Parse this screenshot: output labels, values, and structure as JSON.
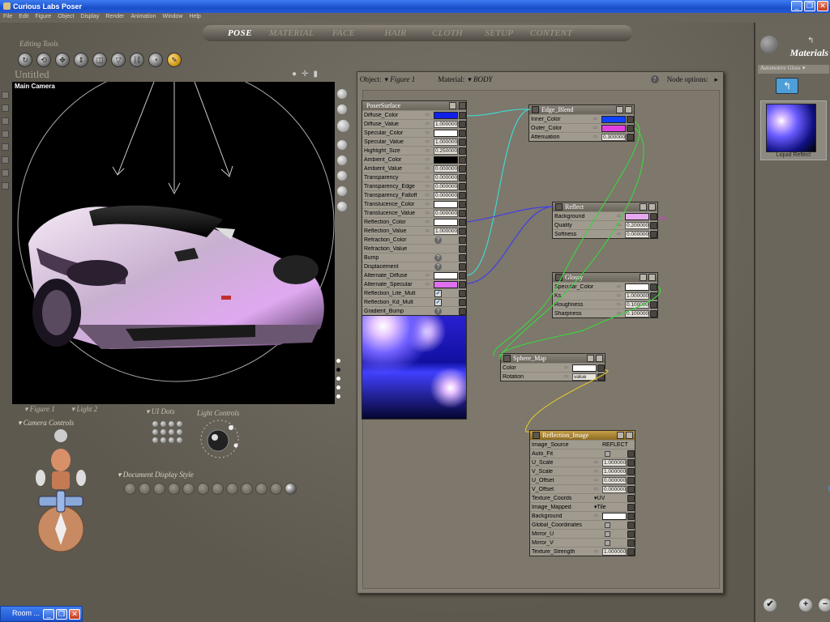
{
  "window": {
    "title": "Curious Labs Poser"
  },
  "menu": [
    "File",
    "Edit",
    "Figure",
    "Object",
    "Display",
    "Render",
    "Animation",
    "Window",
    "Help"
  ],
  "rooms": [
    "POSE",
    "MATERIAL",
    "FACE",
    "HAIR",
    "CLOTH",
    "SETUP",
    "CONTENT"
  ],
  "active_room": "POSE",
  "editing_tools_label": "Editing Tools",
  "document_title": "Untitled",
  "viewport_label": "Main Camera",
  "figure_menu": [
    "Figure 1",
    "Light 2"
  ],
  "ui_dots_label": "UI Dots",
  "light_controls_label": "Light Controls",
  "camera_controls_label": "Camera Controls",
  "document_display_style_label": "Document Display Style",
  "material_panel": {
    "object_label": "Object:",
    "object_value": "Figure 1",
    "material_label": "Material:",
    "material_value": "BODY",
    "help": "?",
    "node_options": "Node options:"
  },
  "nodes": {
    "poser_surface": {
      "title": "PoserSurface",
      "params": [
        {
          "name": "Diffuse_Color",
          "type": "color",
          "color": "#1020e8"
        },
        {
          "name": "Diffuse_Value",
          "type": "value",
          "value": "1.000000"
        },
        {
          "name": "Specular_Color",
          "type": "color",
          "color": "#ffffff"
        },
        {
          "name": "Specular_Value",
          "type": "value",
          "value": "1.000000"
        },
        {
          "name": "Highlight_Size",
          "type": "value",
          "value": "0.250000"
        },
        {
          "name": "Ambient_Color",
          "type": "color",
          "color": "#000000"
        },
        {
          "name": "Ambient_Value",
          "type": "value",
          "value": "0.000000"
        },
        {
          "name": "Transparency",
          "type": "value",
          "value": "0.000000"
        },
        {
          "name": "Transparency_Edge",
          "type": "value",
          "value": "0.000000"
        },
        {
          "name": "Transparency_Falloff",
          "type": "value",
          "value": "0.000000"
        },
        {
          "name": "Translucence_Color",
          "type": "color",
          "color": "#ffffff"
        },
        {
          "name": "Translucence_Value",
          "type": "value",
          "value": "0.000000"
        },
        {
          "name": "Reflection_Color",
          "type": "color",
          "color": "#ffffff"
        },
        {
          "name": "Reflection_Value",
          "type": "value",
          "value": "1.000000"
        },
        {
          "name": "Refraction_Color",
          "type": "q"
        },
        {
          "name": "Refraction_Value",
          "type": "none"
        },
        {
          "name": "Bump",
          "type": "q"
        },
        {
          "name": "Displacement",
          "type": "q"
        },
        {
          "name": "Alternate_Diffuse",
          "type": "color",
          "color": "#ffffff"
        },
        {
          "name": "Alternate_Specular",
          "type": "color",
          "color": "#e070f0"
        },
        {
          "name": "Reflection_Lite_Mult",
          "type": "check"
        },
        {
          "name": "Reflection_Kd_Mult",
          "type": "check"
        },
        {
          "name": "Gradient_Bump",
          "type": "q"
        }
      ]
    },
    "edge_blend": {
      "title": "Edge_Blend",
      "params": [
        {
          "name": "Inner_Color",
          "type": "color",
          "color": "#1040ff"
        },
        {
          "name": "Outer_Color",
          "type": "color",
          "color": "#e040e0"
        },
        {
          "name": "Attenuation",
          "type": "value",
          "value": "0.300000"
        }
      ]
    },
    "reflect": {
      "title": "Reflect",
      "params": [
        {
          "name": "Background",
          "type": "color",
          "color": "#e8a8f0"
        },
        {
          "name": "Quality",
          "type": "value",
          "value": "0.200000"
        },
        {
          "name": "Softness",
          "type": "value",
          "value": "0.000000"
        }
      ]
    },
    "glossy": {
      "title": "Glossy",
      "params": [
        {
          "name": "Specular_Color",
          "type": "color",
          "color": "#ffffff"
        },
        {
          "name": "Ks",
          "type": "value",
          "value": "1.000000"
        },
        {
          "name": "Roughness",
          "type": "value",
          "value": "0.100000"
        },
        {
          "name": "Sharpness",
          "type": "value",
          "value": "0.100000"
        }
      ]
    },
    "sphere_map": {
      "title": "Sphere_Map",
      "params": [
        {
          "name": "Color",
          "type": "color",
          "color": "#ffffff"
        },
        {
          "name": "Rotation",
          "type": "value",
          "value": "value"
        }
      ]
    },
    "reflection_image": {
      "title": "Reflection_Image",
      "params": [
        {
          "name": "Image_Source",
          "type": "text",
          "value": "REFLECT"
        },
        {
          "name": "Auto_Fit",
          "type": "box"
        },
        {
          "name": "U_Scale",
          "type": "value",
          "value": "1.000000"
        },
        {
          "name": "V_Scale",
          "type": "value",
          "value": "1.000000"
        },
        {
          "name": "U_Offset",
          "type": "value",
          "value": "0.000000"
        },
        {
          "name": "V_Offset",
          "type": "value",
          "value": "0.000000"
        },
        {
          "name": "Texture_Coords",
          "type": "dropdown",
          "value": "UV"
        },
        {
          "name": "Image_Mapped",
          "type": "dropdown",
          "value": "Tile"
        },
        {
          "name": "Background",
          "type": "color",
          "color": "#ffffff"
        },
        {
          "name": "Global_Coordinates",
          "type": "box"
        },
        {
          "name": "Mirror_U",
          "type": "box"
        },
        {
          "name": "Mirror_V",
          "type": "box"
        },
        {
          "name": "Texture_Strength",
          "type": "value",
          "value": "1.000000"
        }
      ]
    }
  },
  "library": {
    "title": "Materials",
    "category": "Automotive Gloss",
    "item_name": "Liquid Reflect"
  },
  "taskbar": {
    "item": "Room ..."
  },
  "colors": {
    "wire_cyan": "#40d8d0",
    "wire_blue": "#4040e0",
    "wire_green": "#40d040",
    "wire_yellow": "#d8c030",
    "wire_magenta": "#d040d0"
  }
}
